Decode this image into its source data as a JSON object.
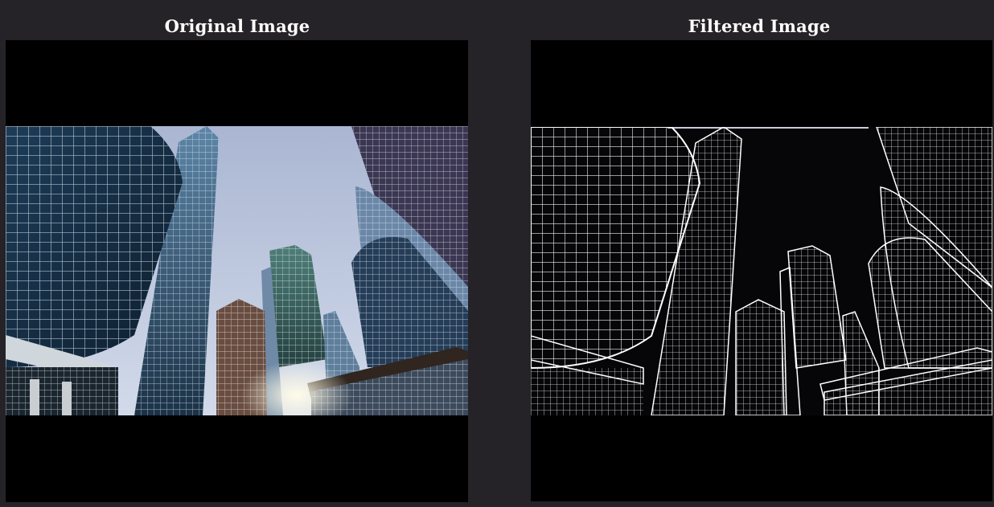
{
  "panels": {
    "original": {
      "title": "Original Image",
      "colors": {
        "sky_top": "#b7c0d8",
        "sky_bottom": "#cdd6ea",
        "glass_dark": "#16304a",
        "glass_mid": "#3b5b76",
        "glass_teal": "#3f6e6a",
        "brick": "#6a4a3a",
        "sun": "#fff6d8"
      }
    },
    "filtered": {
      "title": "Filtered Image",
      "colors": {
        "background": "#050507",
        "edge": "#f2f2f2",
        "edge_dim": "#9aa0b0"
      }
    }
  },
  "icons": {
    "original_image": "skyscrapers-photo-icon",
    "filtered_image": "edge-detected-photo-icon"
  }
}
